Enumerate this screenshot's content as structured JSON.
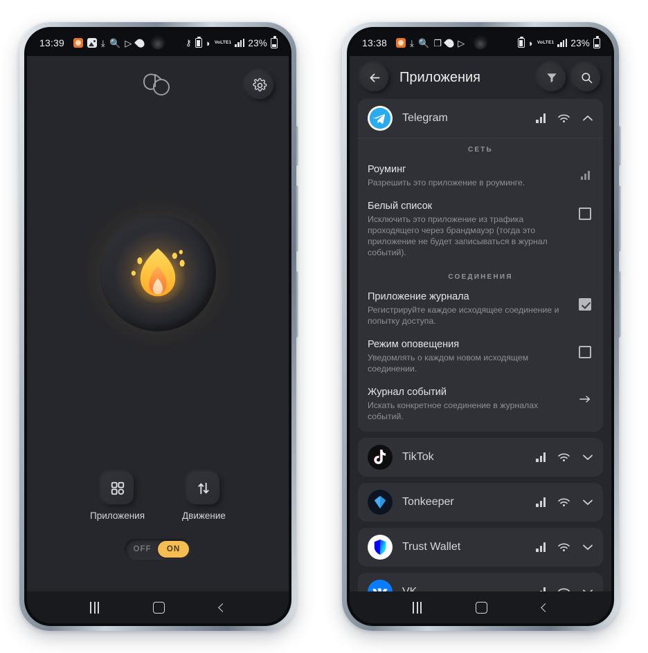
{
  "left_phone": {
    "status_bar": {
      "time": "13:39",
      "battery_percent": "23%",
      "network": "VoLTE1",
      "left_icons": [
        "notification-orange-icon",
        "gallery-icon",
        "download-icon",
        "search-icon",
        "play-store-icon",
        "water-drop-icon"
      ],
      "right_icons": [
        "vpn-key-icon",
        "battery-saver-icon",
        "wifi-icon",
        "volte-icon",
        "signal-bars-icon",
        "battery-icon"
      ]
    },
    "app_logo": "cb-logo-mark",
    "settings_button": "gear-icon",
    "hero_icon": "flame-icon",
    "actions": [
      {
        "label": "Приложения",
        "icon": "grid-apps-icon"
      },
      {
        "label": "Движение",
        "icon": "traffic-arrows-icon"
      }
    ],
    "toggle": {
      "off_label": "OFF",
      "on_label": "ON",
      "selected": "ON",
      "accent": "#f5bd52"
    },
    "nav_bar": [
      "recents-button",
      "home-button",
      "back-button"
    ]
  },
  "right_phone": {
    "status_bar": {
      "time": "13:38",
      "battery_percent": "23%",
      "network": "VoLTE1",
      "left_icons": [
        "notification-orange-icon",
        "download-icon",
        "search-icon",
        "copy-icon",
        "water-drop-icon",
        "play-store-icon"
      ],
      "right_icons": [
        "battery-saver-icon",
        "wifi-icon",
        "volte-icon",
        "signal-bars-icon",
        "battery-icon"
      ]
    },
    "header": {
      "back_button": "arrow-left-icon",
      "title": "Приложения",
      "filter_button": "filter-funnel-icon",
      "search_button": "search-icon"
    },
    "expanded_app": {
      "name": "Telegram",
      "icon": "telegram-icon",
      "row_icons": [
        "signal-bars-icon",
        "wifi-icon",
        "chevron-up-icon"
      ],
      "sections": [
        {
          "title": "СЕТЬ",
          "options": [
            {
              "title": "Роуминг",
              "subtitle": "Разрешить это приложение в роуминге.",
              "control": "signal-bars-icon",
              "checked": false
            },
            {
              "title": "Белый список",
              "subtitle": "Исключить это приложение из трафика проходящего через брандмауэр (тогда это приложение не будет записываться в журнал событий).",
              "control": "checkbox",
              "checked": false
            }
          ]
        },
        {
          "title": "СОЕДИНЕНИЯ",
          "options": [
            {
              "title": "Приложение журнала",
              "subtitle": "Регистрируйте каждое исходящее соединение и попытку доступа.",
              "control": "checkbox",
              "checked": true
            },
            {
              "title": "Режим оповещения",
              "subtitle": "Уведомлять о каждом новом исходящем соединении.",
              "control": "checkbox",
              "checked": false
            },
            {
              "title": "Журнал событий",
              "subtitle": "Искать конкретное соединение в журналах событий.",
              "control": "arrow-right-icon",
              "checked": false
            }
          ]
        }
      ]
    },
    "apps": [
      {
        "name": "TikTok",
        "icon": "tiktok-icon",
        "row_icons": [
          "signal-bars-icon",
          "wifi-icon",
          "chevron-down-icon"
        ]
      },
      {
        "name": "Tonkeeper",
        "icon": "tonkeeper-icon",
        "row_icons": [
          "signal-bars-icon",
          "wifi-icon",
          "chevron-down-icon"
        ]
      },
      {
        "name": "Trust Wallet",
        "icon": "trustwallet-icon",
        "row_icons": [
          "signal-bars-icon",
          "wifi-icon",
          "chevron-down-icon"
        ]
      },
      {
        "name": "VK",
        "icon": "vk-icon",
        "row_icons": [
          "signal-bars-icon",
          "wifi-icon",
          "chevron-down-icon"
        ]
      },
      {
        "name": "",
        "icon": "partial-app-icon",
        "row_icons": []
      }
    ],
    "nav_bar": [
      "recents-button",
      "home-button",
      "back-button"
    ]
  }
}
